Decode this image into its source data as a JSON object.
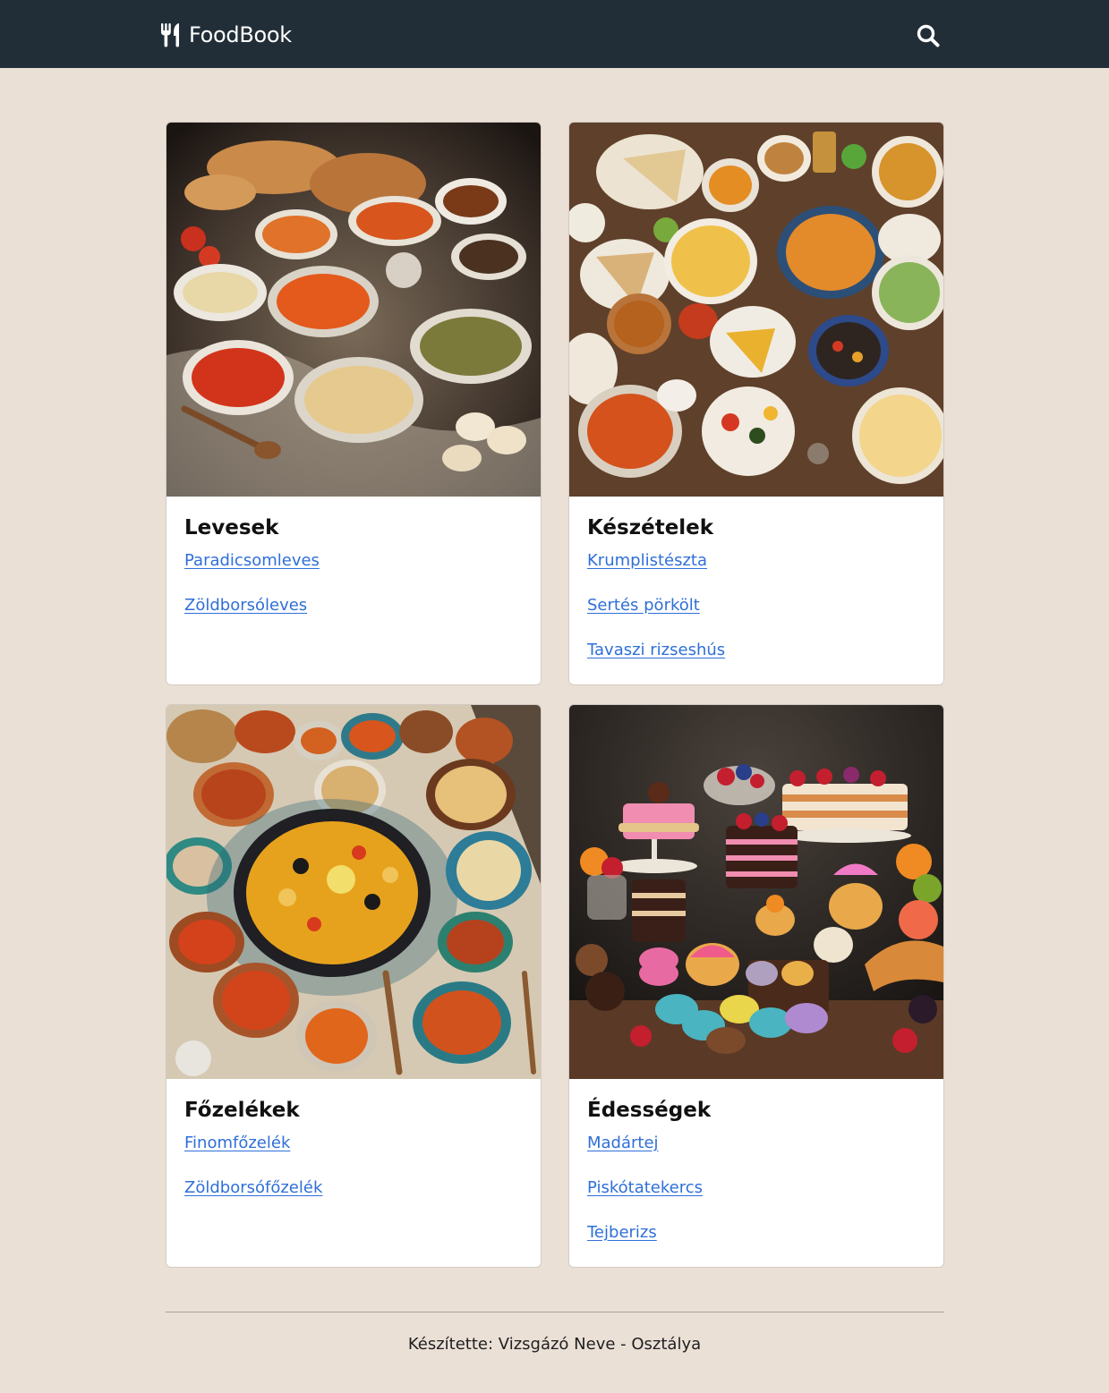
{
  "navbar": {
    "brand": "FoodBook",
    "brand_icon": "utensils-icon",
    "search_icon": "search-icon"
  },
  "categories": [
    {
      "title": "Levesek",
      "image_subject": "soups",
      "links": [
        "Paradicsomleves",
        "Zöldborsóleves"
      ]
    },
    {
      "title": "Készételek",
      "image_subject": "ready-meals",
      "links": [
        "Krumplistészta",
        "Sertés pörkölt",
        "Tavaszi rizseshús"
      ]
    },
    {
      "title": "Főzelékek",
      "image_subject": "stews",
      "links": [
        "Finomfőzelék",
        "Zöldborsófőzelék"
      ]
    },
    {
      "title": "Édességek",
      "image_subject": "desserts",
      "links": [
        "Madártej",
        "Piskótatekercs",
        "Tejberizs"
      ]
    }
  ],
  "footer": {
    "text": "Készítette: Vizsgázó Neve - Osztálya"
  },
  "colors": {
    "navbar_bg": "#212e38",
    "page_bg": "#ebe0d6",
    "link": "#2f6fd8",
    "card_bg": "#ffffff"
  }
}
